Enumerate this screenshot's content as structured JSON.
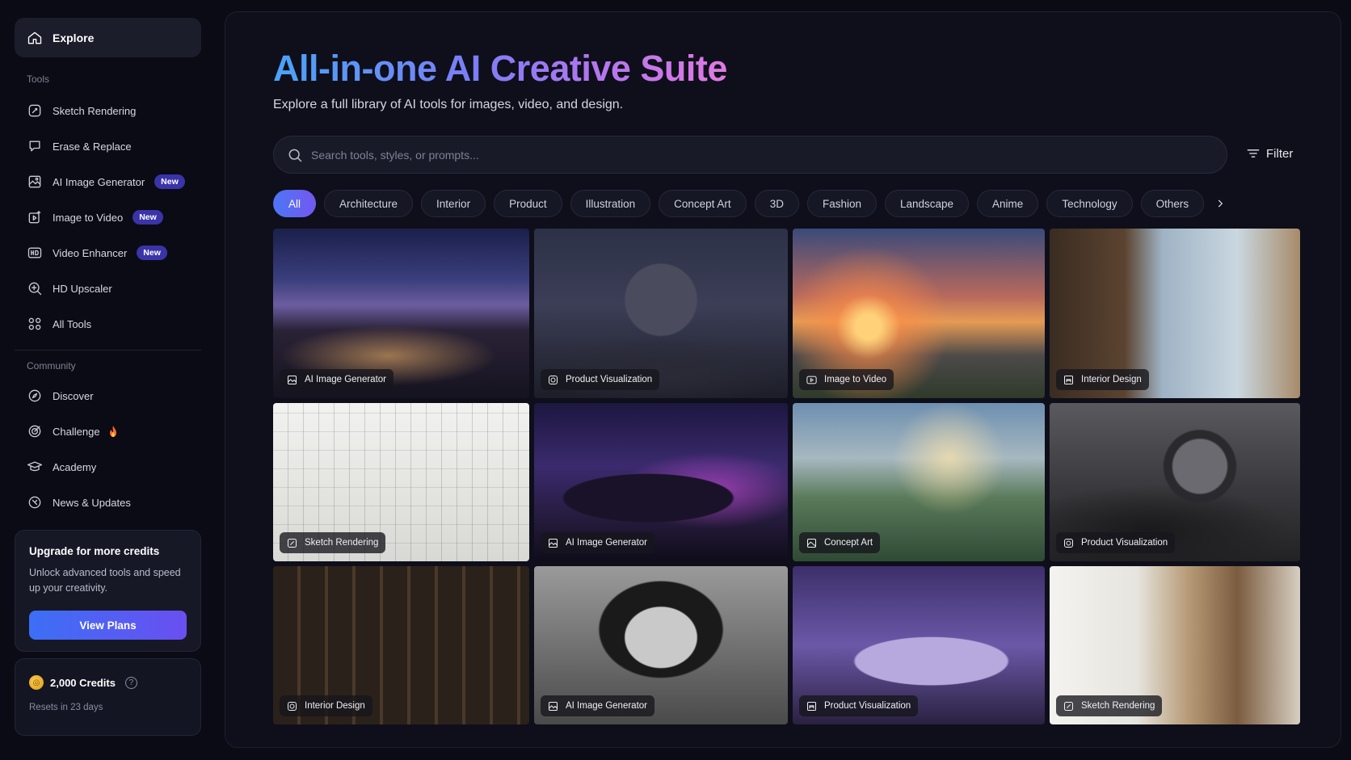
{
  "sidebar": {
    "explore_label": "Explore",
    "tools_section": "Tools",
    "tools": [
      {
        "label": "Sketch Rendering",
        "icon": "sketch-rendering-icon",
        "badge": ""
      },
      {
        "label": "Erase & Replace",
        "icon": "erase-replace-icon",
        "badge": ""
      },
      {
        "label": "AI Image Generator",
        "icon": "image-generator-icon",
        "badge": "New"
      },
      {
        "label": "Image to Video",
        "icon": "image-to-video-icon",
        "badge": "New"
      },
      {
        "label": "Video Enhancer",
        "icon": "hd-video-icon",
        "badge": "New"
      },
      {
        "label": "HD Upscaler",
        "icon": "zoom-plus-icon",
        "badge": ""
      },
      {
        "label": "All Tools",
        "icon": "grid-icon",
        "badge": ""
      }
    ],
    "community_section": "Community",
    "community": [
      {
        "label": "Discover",
        "icon": "compass-icon"
      },
      {
        "label": "Challenge",
        "icon": "target-icon",
        "extra_icon": "fire-icon"
      },
      {
        "label": "Academy",
        "icon": "graduation-cap-icon"
      },
      {
        "label": "News & Updates",
        "icon": "news-icon"
      }
    ],
    "upgrade": {
      "title": "Upgrade for more credits",
      "description": "Unlock advanced tools and speed up your creativity.",
      "button_label": "View Plans"
    },
    "credits": {
      "amount": "2,000 Credits",
      "resets": "Resets in 23 days",
      "coin_symbol": "◎",
      "help_symbol": "?"
    }
  },
  "main": {
    "title": "All-in-one AI Creative Suite",
    "subtitle": "Explore a full library of AI tools for images, video, and design.",
    "search_placeholder": "Search tools, styles, or prompts...",
    "filter_label": "Filter",
    "categories": [
      "All",
      "Architecture",
      "Interior",
      "Product",
      "Illustration",
      "Concept Art",
      "3D",
      "Fashion",
      "Landscape",
      "Anime",
      "Technology",
      "Others"
    ],
    "active_category": "All",
    "cards": [
      {
        "tag": "AI Image Generator",
        "icon": "image-generator-icon",
        "scene": "house"
      },
      {
        "tag": "Product Visualization",
        "icon": "product-icon",
        "scene": "speaker"
      },
      {
        "tag": "Image to Video",
        "icon": "image-to-video-icon",
        "scene": "anime"
      },
      {
        "tag": "Interior Design",
        "icon": "interior-icon",
        "scene": "interior"
      },
      {
        "tag": "Sketch Rendering",
        "icon": "sketch-rendering-icon",
        "scene": "sketch"
      },
      {
        "tag": "AI Image Generator",
        "icon": "image-generator-icon",
        "scene": "car"
      },
      {
        "tag": "Concept Art",
        "icon": "concept-art-icon",
        "scene": "fantasy"
      },
      {
        "tag": "Product Visualization",
        "icon": "product-icon",
        "scene": "watch"
      },
      {
        "tag": "Interior Design",
        "icon": "product-icon",
        "scene": "store"
      },
      {
        "tag": "AI Image Generator",
        "icon": "image-generator-icon",
        "scene": "portrait"
      },
      {
        "tag": "Product Visualization",
        "icon": "interior-icon",
        "scene": "shoes"
      },
      {
        "tag": "Sketch Rendering",
        "icon": "sketch-rendering-icon",
        "scene": "sketch-room"
      }
    ]
  },
  "colors": {
    "background": "#0a0b14",
    "panel": "#0e0f1a",
    "accent_blue": "#3c6ff5",
    "accent_purple": "#6a4ff0",
    "badge": "#3b33a8",
    "title_gradient": [
      "#4aa3f8",
      "#7e7df5",
      "#b076f0",
      "#e07ae2"
    ]
  }
}
